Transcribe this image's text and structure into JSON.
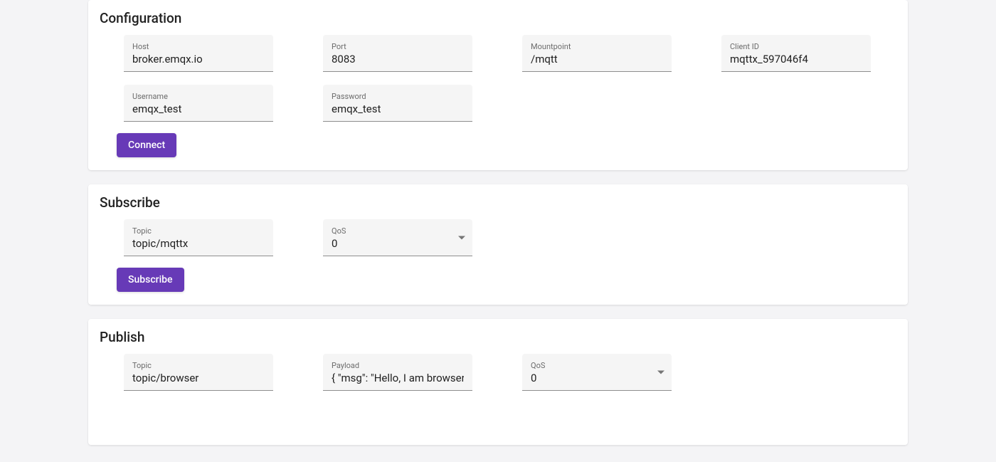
{
  "configuration": {
    "title": "Configuration",
    "host": {
      "label": "Host",
      "value": "broker.emqx.io"
    },
    "port": {
      "label": "Port",
      "value": "8083"
    },
    "mountpoint": {
      "label": "Mountpoint",
      "value": "/mqtt"
    },
    "client_id": {
      "label": "Client ID",
      "value": "mqttx_597046f4"
    },
    "username": {
      "label": "Username",
      "value": "emqx_test"
    },
    "password": {
      "label": "Password",
      "value": "emqx_test"
    },
    "connect_label": "Connect"
  },
  "subscribe": {
    "title": "Subscribe",
    "topic": {
      "label": "Topic",
      "value": "topic/mqttx"
    },
    "qos": {
      "label": "QoS",
      "value": "0"
    },
    "subscribe_label": "Subscribe"
  },
  "publish": {
    "title": "Publish",
    "topic": {
      "label": "Topic",
      "value": "topic/browser"
    },
    "payload": {
      "label": "Payload",
      "value": "{ \"msg\": \"Hello, I am browser.\""
    },
    "qos": {
      "label": "QoS",
      "value": "0"
    }
  }
}
